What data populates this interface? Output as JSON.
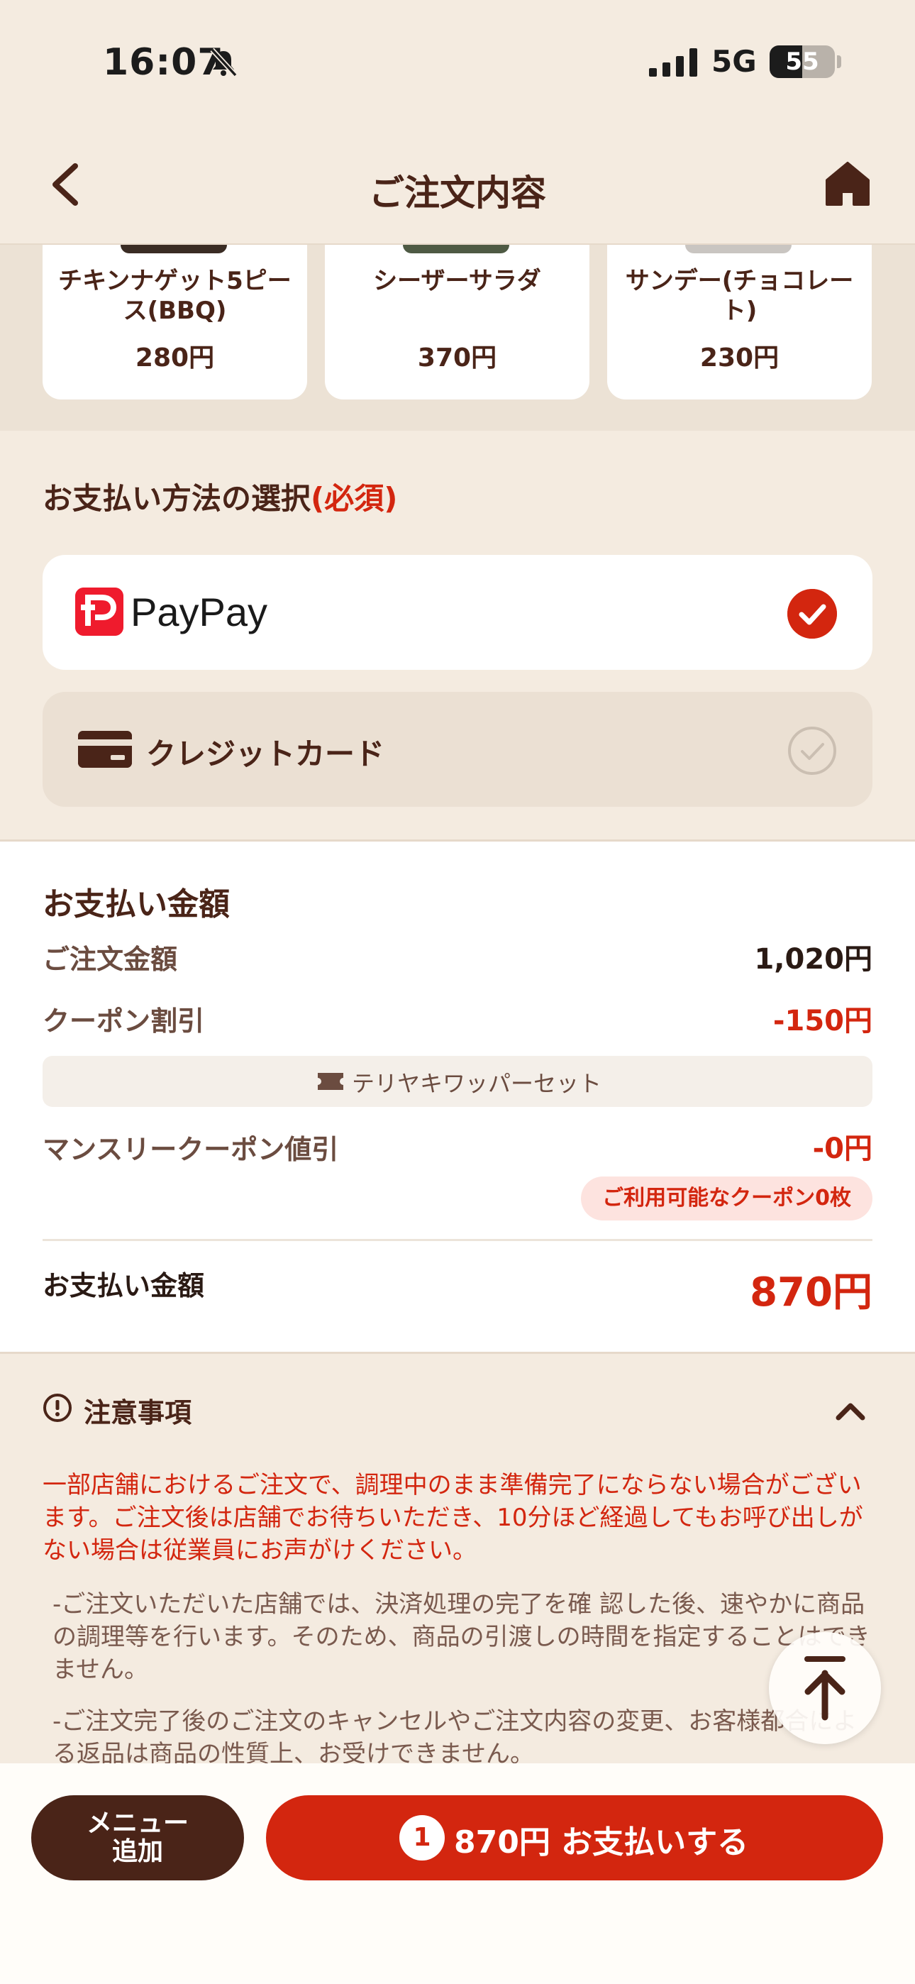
{
  "status_bar": {
    "time": "16:07",
    "network": "5G",
    "battery": "55"
  },
  "header": {
    "title": "ご注文内容"
  },
  "recommend_items": [
    {
      "name": "チキンナゲット5ピース(BBQ)",
      "price": "280円"
    },
    {
      "name": "シーザーサラダ",
      "price": "370円"
    },
    {
      "name": "サンデー(チョコレート)",
      "price": "230円"
    }
  ],
  "payment": {
    "heading": "お支払い方法の選択",
    "required": "(必須)",
    "options": [
      {
        "label": "PayPay",
        "selected": true
      },
      {
        "label": "クレジットカード",
        "selected": false
      }
    ]
  },
  "amount": {
    "heading": "お支払い金額",
    "order_label": "ご注文金額",
    "order_value": "1,020円",
    "coupon_label": "クーポン割引",
    "coupon_value": "-150円",
    "coupon_name": "テリヤキワッパーセット",
    "monthly_label": "マンスリークーポン値引",
    "monthly_value": "-0円",
    "available_coupons": "ご利用可能なクーポン0枚",
    "total_label": "お支払い金額",
    "total_value": "870円"
  },
  "notice": {
    "title": "注意事項",
    "warning": "一部店舗におけるご注文で、調理中のまま準備完了にならない場合がございます。ご注文後は店舗でお待ちいただき、10分ほど経過してもお呼び出しがない場合は従業員にお声がけください。",
    "items": [
      "-ご注文いただいた店舗では、決済処理の完了を確 認した後、速やかに商品の調理等を行います。そのため、商品の引渡しの時間を指定することはできません。",
      "-ご注文完了後のご注文のキャンセルやご注文内容の変更、お客様都合による返品は商品の性質上、お受けできません。"
    ]
  },
  "bottom_bar": {
    "menu_add": "メニュー追加",
    "cart_count": "1",
    "pay_label": "870円 お支払いする"
  },
  "colors": {
    "accent_red": "#d3260f",
    "brand_brown": "#4a2418",
    "background": "#f4ebe0",
    "paypay_red": "#ef1b2d"
  }
}
